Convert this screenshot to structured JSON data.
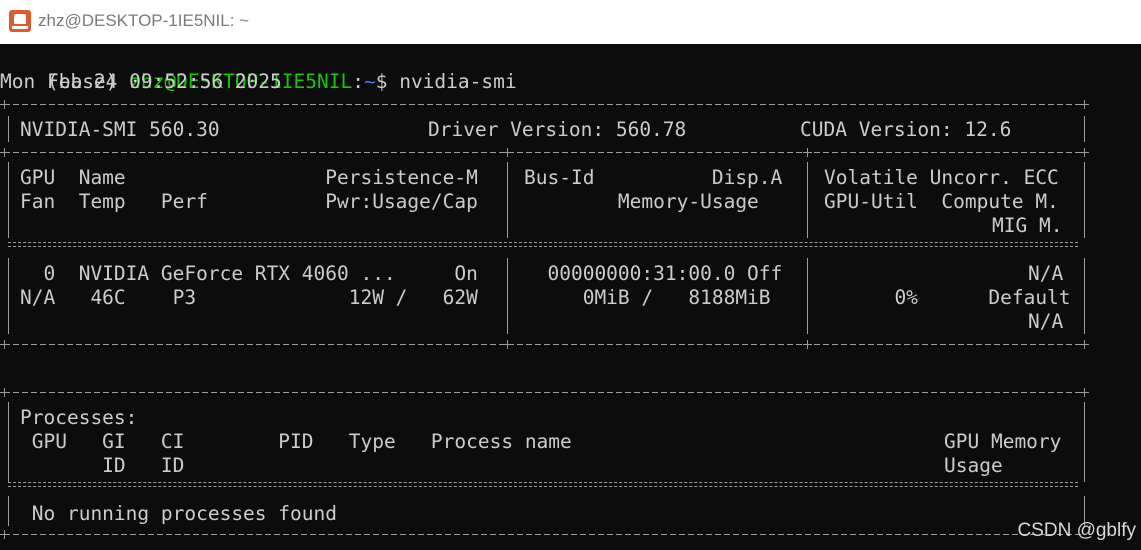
{
  "window": {
    "title": "zhz@DESKTOP-1IE5NIL: ~"
  },
  "terminal": {
    "prompt": {
      "env": "(base) ",
      "user_host": "zhz@DESKTOP-1IE5NIL",
      "colon": ":",
      "path": "~",
      "symbol": "$ ",
      "command": "nvidia-smi"
    },
    "timestamp": "Mon Feb 24 09:52:56 2025",
    "header": {
      "smi_version": "NVIDIA-SMI 560.30",
      "driver_version": "Driver Version: 560.78",
      "cuda_version": "CUDA Version: 12.6"
    },
    "gpu_columns": {
      "c1_r1": "GPU  Name                 Persistence-M",
      "c1_r2": "Fan  Temp   Perf          Pwr:Usage/Cap",
      "c2_r1": "Bus-Id          Disp.A",
      "c2_r2": "        Memory-Usage",
      "c3_r1": "Volatile Uncorr. ECC",
      "c3_r2": "GPU-Util  Compute M.",
      "c3_r3": "MIG M."
    },
    "gpu_row": {
      "c1_r1": "  0  NVIDIA GeForce RTX 4060 ...     On",
      "c1_r2": "N/A   46C    P3             12W /   62W",
      "c2_r1": "  00000000:31:00.0 Off",
      "c2_r2": "     0MiB /   8188MiB",
      "c3_r1": "N/A",
      "c3_r2": "      0%      Default",
      "c3_r3": "N/A"
    },
    "processes": {
      "title": "Processes:",
      "header_r1": " GPU   GI   CI        PID   Type   Process name",
      "header_r1_right": "GPU Memory",
      "header_r2": "       ID   ID",
      "header_r2_right": "Usage",
      "empty_message": " No running processes found"
    }
  },
  "watermark": "CSDN @gblfy"
}
